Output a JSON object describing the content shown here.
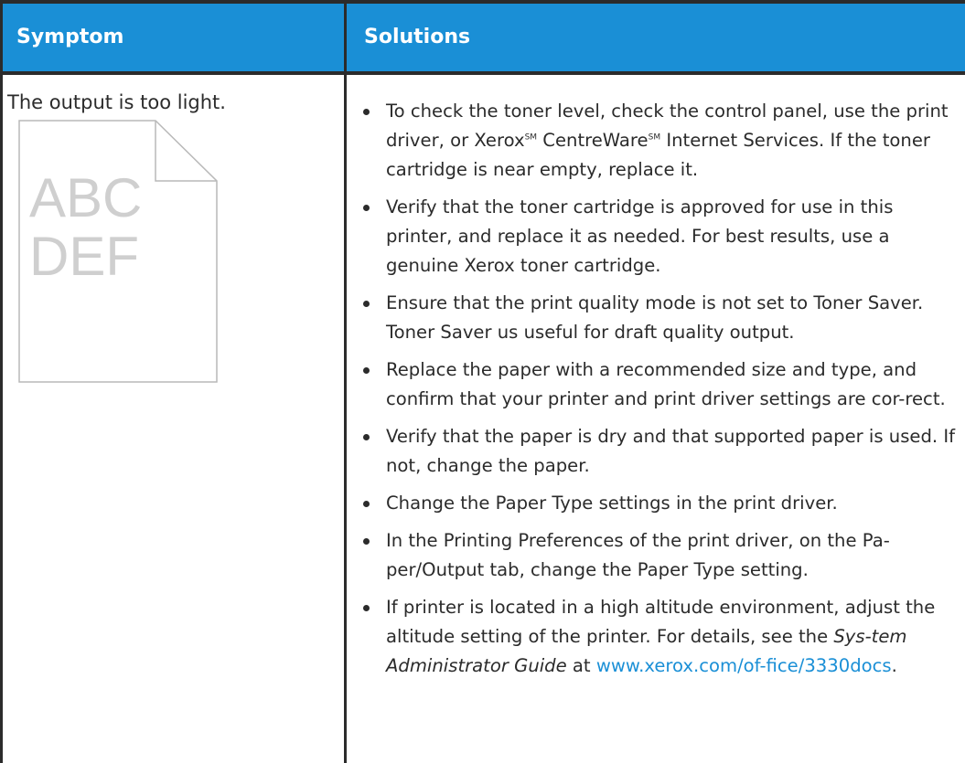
{
  "table": {
    "header": {
      "symptom": "Symptom",
      "solutions": "Solutions"
    },
    "row": {
      "symptom": "The output is too light.",
      "illustration_lines": [
        "ABC",
        "DEF"
      ],
      "solutions": [
        {
          "pre": "To check the toner level, check the control panel, use the print driver, or Xerox",
          "sm1": "SM",
          "mid": " CentreWare",
          "sm2": "SM",
          "post": " Internet Services. If the toner cartridge is near empty, replace it."
        },
        {
          "text": "Verify that the toner cartridge is approved for use in this printer, and replace it as needed. For best results, use a genuine Xerox toner cartridge."
        },
        {
          "text": "Ensure that the print quality mode is not set to Toner Saver. Toner Saver us useful for draft quality output."
        },
        {
          "text": "Replace the paper with a recommended size and type, and confirm that your printer and print driver settings are cor-rect."
        },
        {
          "text": "Verify that the paper is dry and that supported paper is used. If not, change the paper."
        },
        {
          "text": "Change the Paper Type settings in the print driver."
        },
        {
          "text": "In the Printing Preferences of the print driver, on the Pa-per/Output tab, change the Paper Type setting."
        },
        {
          "pre": "If printer is located in a high altitude environment, adjust the altitude setting of the printer. For details, see the ",
          "guide": "Sys-tem Administrator Guide",
          "at": " at ",
          "link": "www.xerox.com/of-fice/3330docs",
          "end": "."
        }
      ]
    }
  },
  "colors": {
    "header_bg": "#1a8fd6",
    "link": "#1a8fd6",
    "rule": "#2b2b2b"
  }
}
